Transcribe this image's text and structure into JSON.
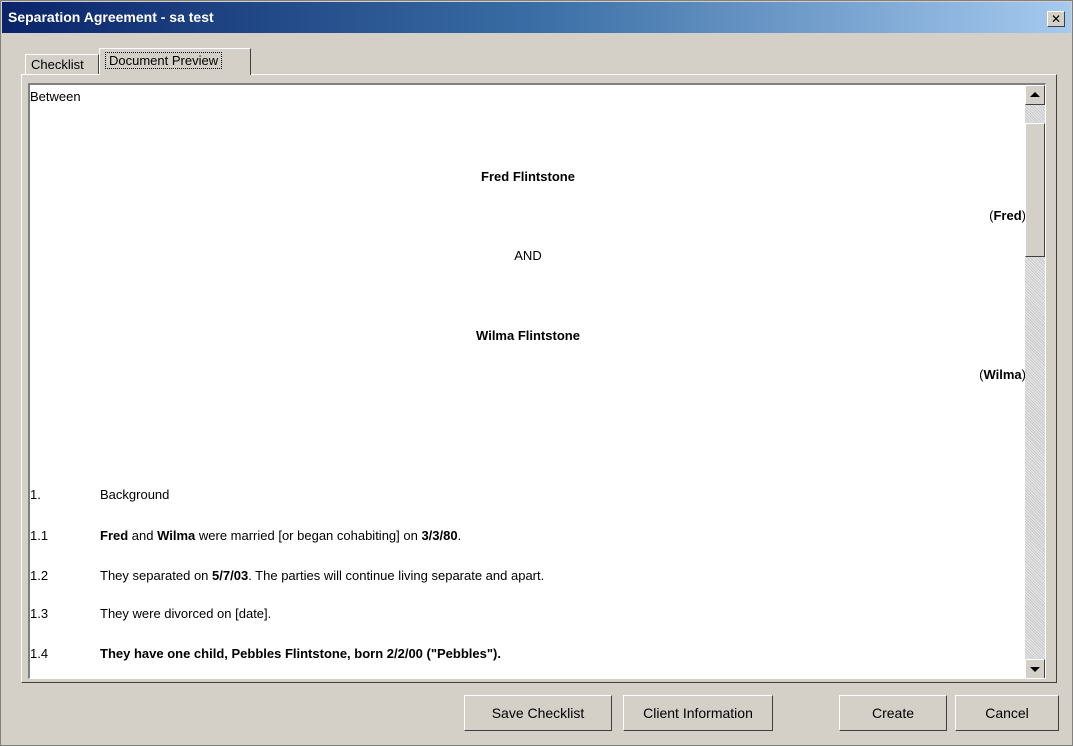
{
  "window": {
    "title": "Separation Agreement - sa test",
    "close_glyph": "✕"
  },
  "tabs": [
    {
      "label": "Checklist"
    },
    {
      "label": "Document Preview",
      "active": true
    }
  ],
  "document": {
    "between": "Between",
    "party1_name": "Fred Flintstone",
    "party1_short_open": "(",
    "party1_short": "Fred",
    "party1_short_close": ")",
    "and": "AND",
    "party2_name": "Wilma Flintstone",
    "party2_short_open": "(",
    "party2_short": "Wilma",
    "party2_short_close": ")",
    "paragraphs": [
      {
        "num": "1.",
        "text": "Background"
      },
      {
        "num": "1.1",
        "parts": [
          "Fred",
          " and ",
          "Wilma",
          " were married [or began cohabiting] on ",
          "3/3/80",
          "."
        ]
      },
      {
        "num": "1.2",
        "parts": [
          "They separated on ",
          "5/7/03",
          ". The parties will continue living separate and apart."
        ]
      },
      {
        "num": "1.3",
        "text": "They were divorced on [date]."
      },
      {
        "num": "1.4",
        "text": "They have one child, Pebbles Flintstone, born 2/2/00 (\"Pebbles\")."
      }
    ]
  },
  "buttons": {
    "save_checklist": "Save Checklist",
    "client_information": "Client Information",
    "create": "Create",
    "cancel": "Cancel"
  },
  "colors": {
    "titlebar": "#0a246a",
    "face": "#d4d0c8"
  }
}
